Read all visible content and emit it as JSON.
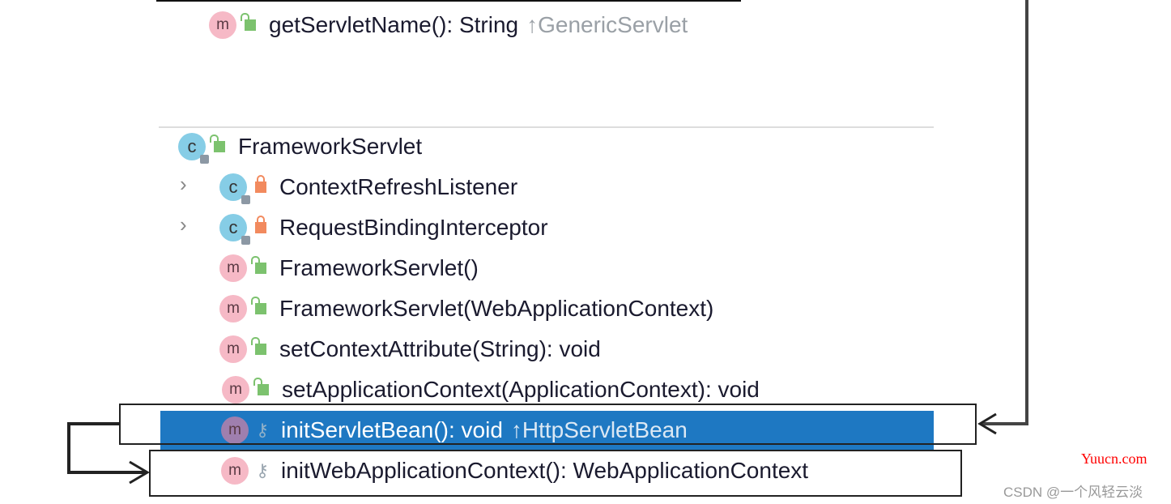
{
  "top_item": {
    "name": "getServletName(): String",
    "inherited": "↑GenericServlet",
    "icon": "method-icon",
    "access": "public"
  },
  "class_node": {
    "name": "FrameworkServlet",
    "icon": "class-icon",
    "access": "public"
  },
  "members": [
    {
      "name": "ContextRefreshListener",
      "icon": "class-icon",
      "access": "private",
      "expandable": true
    },
    {
      "name": "RequestBindingInterceptor",
      "icon": "class-icon",
      "access": "private",
      "expandable": true
    },
    {
      "name": "FrameworkServlet()",
      "icon": "method-icon",
      "access": "public"
    },
    {
      "name": "FrameworkServlet(WebApplicationContext)",
      "icon": "method-icon",
      "access": "public"
    },
    {
      "name": "setContextAttribute(String): void",
      "icon": "method-icon",
      "access": "public"
    },
    {
      "name": "setApplicationContext(ApplicationContext): void",
      "icon": "method-icon",
      "access": "public"
    },
    {
      "name": "initServletBean(): void",
      "inherited": "↑HttpServletBean",
      "icon": "method-icon",
      "access": "protected",
      "selected": true
    },
    {
      "name": "initWebApplicationContext(): WebApplicationContext",
      "icon": "method-icon",
      "access": "protected"
    }
  ],
  "icon_letters": {
    "method": "m",
    "class": "c"
  },
  "chevron": "›",
  "key_glyph": "⚷",
  "colors": {
    "selection": "#1e78c2",
    "method_icon": "#f6b9c6",
    "class_icon": "#86cde6",
    "watermark_red": "#ff0000"
  },
  "watermarks": {
    "site": "Yuucn.com",
    "author": "CSDN @一个风轻云淡"
  }
}
